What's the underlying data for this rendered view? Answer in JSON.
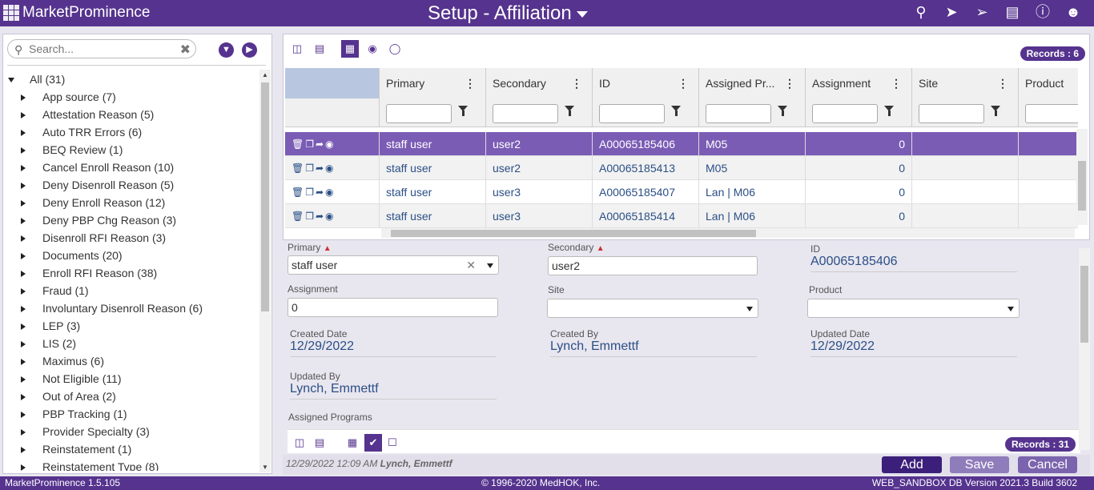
{
  "app": {
    "name": "MarketProminence",
    "page_title": "Setup - Affiliation"
  },
  "top_icons": [
    "search-icon",
    "rocket-icon",
    "send-icon",
    "card-icon",
    "info-icon",
    "user-icon"
  ],
  "sidebar": {
    "search_placeholder": "Search...",
    "root": "All (31)",
    "items": [
      "App source (7)",
      "Attestation Reason (5)",
      "Auto TRR Errors (6)",
      "BEQ Review (1)",
      "Cancel Enroll Reason (10)",
      "Deny Disenroll Reason (5)",
      "Deny Enroll Reason (12)",
      "Deny PBP Chg Reason (3)",
      "Disenroll RFI Reason (3)",
      "Documents (20)",
      "Enroll RFI Reason (38)",
      "Fraud (1)",
      "Involuntary Disenroll Reason (6)",
      "LEP (3)",
      "LIS (2)",
      "Maximus (6)",
      "Not Eligible (11)",
      "Out of Area (2)",
      "PBP Tracking (1)",
      "Provider Specialty (3)",
      "Reinstatement (1)",
      "Reinstatement Type (8)"
    ]
  },
  "grid": {
    "records": "Records : 6",
    "columns": [
      "Primary",
      "Secondary",
      "ID",
      "Assigned Pr...",
      "Assignment",
      "Site",
      "Product"
    ],
    "rows": [
      {
        "primary": "staff user",
        "secondary": "user2",
        "id": "A00065185406",
        "program": "M05",
        "assignment": "0",
        "site": "",
        "product": ""
      },
      {
        "primary": "staff user",
        "secondary": "user2",
        "id": "A00065185413",
        "program": "M05",
        "assignment": "0",
        "site": "",
        "product": ""
      },
      {
        "primary": "staff user",
        "secondary": "user3",
        "id": "A00065185407",
        "program": "Lan | M06",
        "assignment": "0",
        "site": "",
        "product": ""
      },
      {
        "primary": "staff user",
        "secondary": "user3",
        "id": "A00065185414",
        "program": "Lan | M06",
        "assignment": "0",
        "site": "",
        "product": ""
      }
    ]
  },
  "form": {
    "primary_label": "Primary",
    "primary_value": "staff user",
    "secondary_label": "Secondary",
    "secondary_value": "user2",
    "id_label": "ID",
    "id_value": "A00065185406",
    "assignment_label": "Assignment",
    "assignment_value": "0",
    "site_label": "Site",
    "product_label": "Product",
    "created_date_label": "Created Date",
    "created_date_value": "12/29/2022",
    "created_by_label": "Created By",
    "created_by_value": "Lynch, Emmettf",
    "updated_date_label": "Updated Date",
    "updated_date_value": "12/29/2022",
    "updated_by_label": "Updated By",
    "updated_by_value": "Lynch, Emmettf",
    "assigned_programs_label": "Assigned Programs",
    "sub_records": "Records : 31"
  },
  "footer": {
    "audit_time": "12/29/2022 12:09 AM",
    "audit_user": "Lynch, Emmettf",
    "add": "Add",
    "save": "Save",
    "cancel": "Cancel"
  },
  "status": {
    "version": "MarketProminence 1.5.105",
    "copyright": "© 1996-2020 MedHOK, Inc.",
    "db": "WEB_SANDBOX DB Version 2021.3 Build 3602"
  },
  "colors": {
    "brand": "#55338e",
    "selected_row": "#7a5cb5"
  }
}
